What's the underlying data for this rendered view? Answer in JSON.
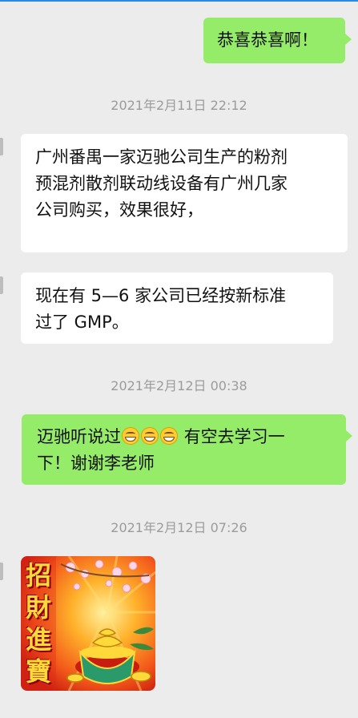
{
  "messages": [
    {
      "type": "sent",
      "text": "恭喜恭喜啊！"
    },
    {
      "type": "time",
      "text": "2021年2月11日 22:12"
    },
    {
      "type": "recv",
      "lines": [
        "广州番禺一家迈驰公司生产的粉剂",
        "预混剂散剂联动线设备有广州几家",
        "公司购买，效果很好，"
      ]
    },
    {
      "type": "recv",
      "lines": [
        "现在有 5—6 家公司已经按新标准",
        "过了 GMP。"
      ]
    },
    {
      "type": "time",
      "text": "2021年2月12日 00:38"
    },
    {
      "type": "sent",
      "line1_before": "迈驰听说过",
      "line1_after": " 有空去学习一",
      "line2": "下！谢谢李老师",
      "emoji": [
        "grin-emoji",
        "grin-emoji",
        "grin-emoji"
      ]
    },
    {
      "type": "time",
      "text": "2021年2月12日 07:26"
    },
    {
      "type": "sticker",
      "chars": [
        "招",
        "財",
        "進",
        "寶"
      ]
    }
  ],
  "colors": {
    "sent_bubble": "#95ec69",
    "recv_bubble": "#ffffff",
    "background": "#ececec",
    "timestamp": "#9b9b9b"
  }
}
